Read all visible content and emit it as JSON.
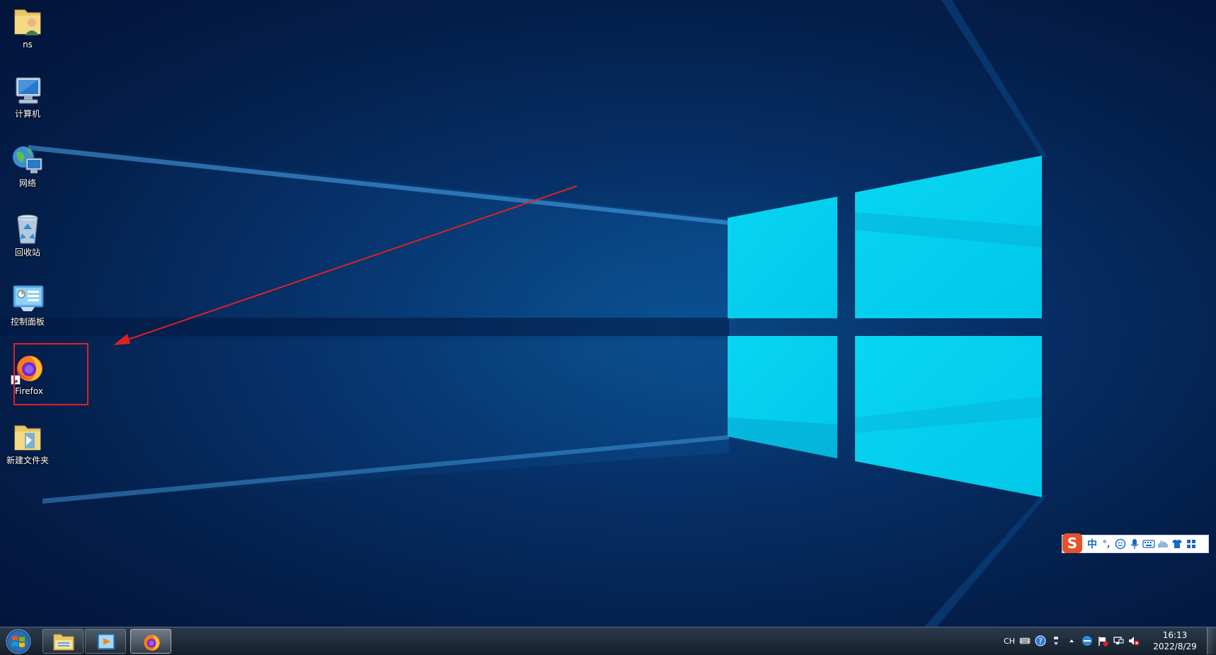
{
  "desktop": {
    "icons": [
      {
        "label": "ns",
        "icon": "user-folder-icon"
      },
      {
        "label": "计算机",
        "icon": "computer-icon"
      },
      {
        "label": "网络",
        "icon": "network-icon"
      },
      {
        "label": "回收站",
        "icon": "recycle-bin-icon"
      },
      {
        "label": "控制面板",
        "icon": "control-panel-icon"
      },
      {
        "label": "Firefox",
        "icon": "firefox-icon"
      },
      {
        "label": "新建文件夹",
        "icon": "folder-icon"
      }
    ],
    "annotation_color": "#e02020"
  },
  "ime": {
    "logo": "S",
    "mode": "中",
    "punct": "°,",
    "items": [
      "emoji-icon",
      "microphone-icon",
      "keyboard-icon",
      "toolbox-icon",
      "skin-icon",
      "menu-grid-icon"
    ]
  },
  "taskbar": {
    "start": "start-orb-icon",
    "pinned": [
      "explorer-icon",
      "media-player-icon",
      "firefox-icon"
    ],
    "tray": {
      "language": "CH",
      "time": "16:13",
      "date": "2022/8/29"
    }
  }
}
